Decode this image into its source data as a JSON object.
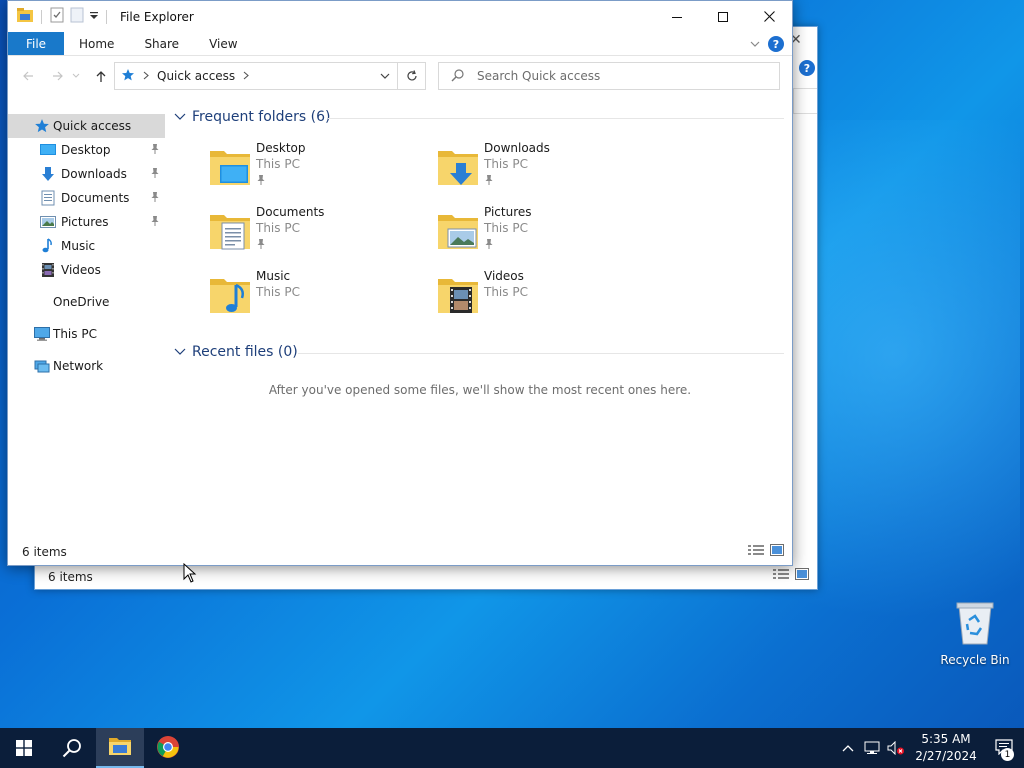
{
  "window": {
    "title": "File Explorer",
    "ribbon_tabs": [
      "File",
      "Home",
      "Share",
      "View"
    ],
    "help_label": "?"
  },
  "address": {
    "path": "Quick access",
    "search_placeholder": "Search Quick access"
  },
  "nav": {
    "quick_access": "Quick access",
    "pinned": [
      {
        "label": "Desktop"
      },
      {
        "label": "Downloads"
      },
      {
        "label": "Documents"
      },
      {
        "label": "Pictures"
      }
    ],
    "others": [
      {
        "label": "Music"
      },
      {
        "label": "Videos"
      }
    ],
    "onedrive": "OneDrive",
    "this_pc": "This PC",
    "network": "Network"
  },
  "frequent": {
    "header": "Frequent folders (6)",
    "folders": [
      {
        "name": "Desktop",
        "location": "This PC",
        "pinned": true
      },
      {
        "name": "Downloads",
        "location": "This PC",
        "pinned": true
      },
      {
        "name": "Documents",
        "location": "This PC",
        "pinned": true
      },
      {
        "name": "Pictures",
        "location": "This PC",
        "pinned": true
      },
      {
        "name": "Music",
        "location": "This PC",
        "pinned": false
      },
      {
        "name": "Videos",
        "location": "This PC",
        "pinned": false
      }
    ]
  },
  "recent": {
    "header": "Recent files (0)",
    "empty_message": "After you've opened some files, we'll show the most recent ones here."
  },
  "status": {
    "item_count": "6 items",
    "bg_item_count": "6 items"
  },
  "desktop": {
    "recycle_bin": "Recycle Bin"
  },
  "taskbar": {
    "time": "5:35 AM",
    "date": "2/27/2024",
    "notification_count": "1"
  },
  "colors": {
    "accent": "#1979ca",
    "taskbar": "#0b1e3a",
    "group_header": "#1e3f7a"
  }
}
